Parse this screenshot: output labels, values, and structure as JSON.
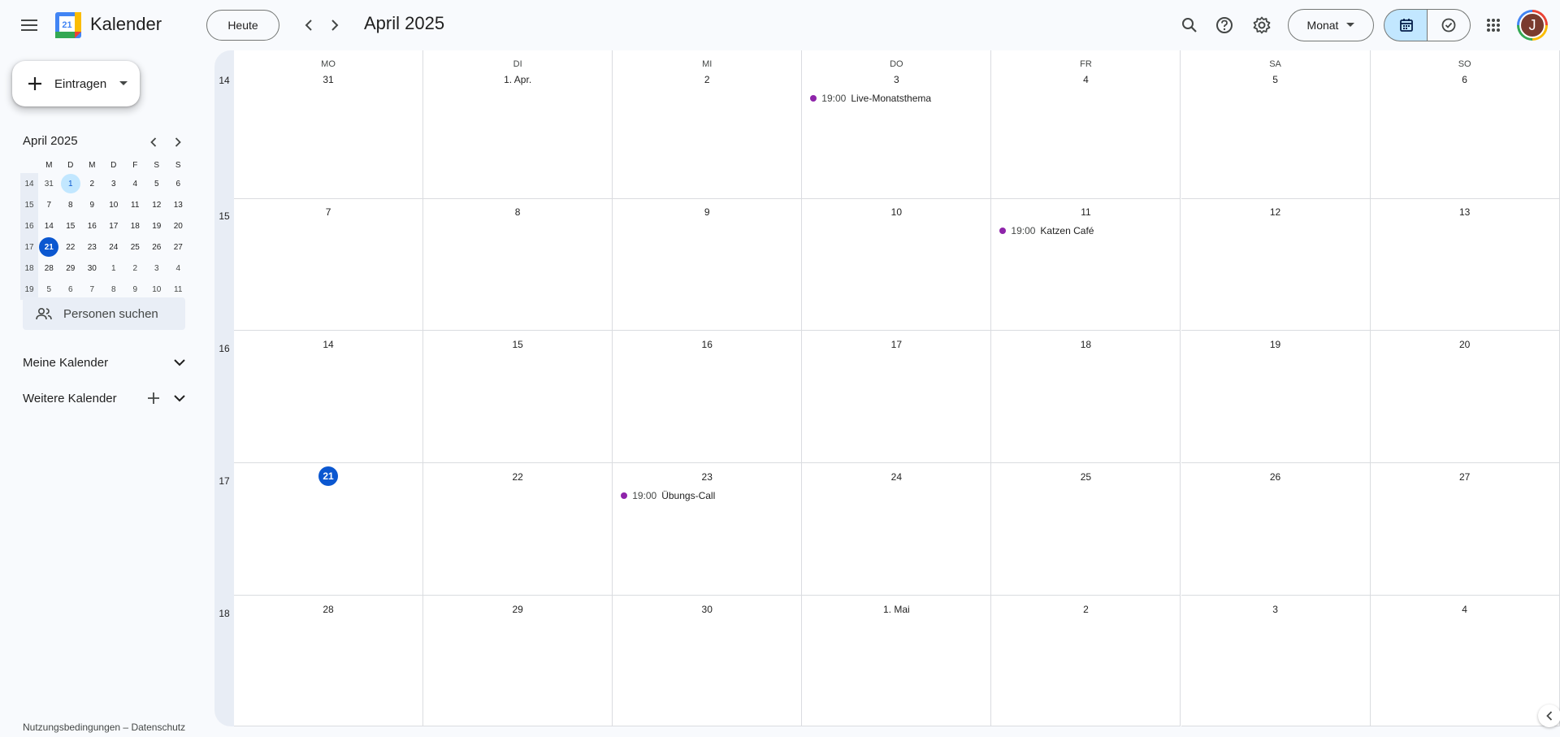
{
  "app": {
    "title": "Kalender",
    "logo_day": "21"
  },
  "header": {
    "today_label": "Heute",
    "current_period": "April 2025",
    "view_label": "Monat",
    "avatar_initial": "J"
  },
  "sidebar": {
    "create_label": "Eintragen",
    "mini_calendar": {
      "title": "April 2025",
      "weekday_headers": [
        "M",
        "D",
        "M",
        "D",
        "F",
        "S",
        "S"
      ],
      "weeks": [
        {
          "wk": "14",
          "days": [
            "31",
            "1",
            "2",
            "3",
            "4",
            "5",
            "6"
          ]
        },
        {
          "wk": "15",
          "days": [
            "7",
            "8",
            "9",
            "10",
            "11",
            "12",
            "13"
          ]
        },
        {
          "wk": "16",
          "days": [
            "14",
            "15",
            "16",
            "17",
            "18",
            "19",
            "20"
          ]
        },
        {
          "wk": "17",
          "days": [
            "21",
            "22",
            "23",
            "24",
            "25",
            "26",
            "27"
          ]
        },
        {
          "wk": "18",
          "days": [
            "28",
            "29",
            "30",
            "1",
            "2",
            "3",
            "4"
          ]
        },
        {
          "wk": "19",
          "days": [
            "5",
            "6",
            "7",
            "8",
            "9",
            "10",
            "11"
          ]
        }
      ]
    },
    "people_search_placeholder": "Personen suchen",
    "my_calendars_label": "Meine Kalender",
    "other_calendars_label": "Weitere Kalender",
    "footer": "Nutzungsbedingungen – Datenschutz"
  },
  "month_grid": {
    "weekday_headers": [
      "MO",
      "DI",
      "MI",
      "DO",
      "FR",
      "SA",
      "SO"
    ],
    "weeks": [
      {
        "wk": "14",
        "days": [
          "31",
          "1. Apr.",
          "2",
          "3",
          "4",
          "5",
          "6"
        ]
      },
      {
        "wk": "15",
        "days": [
          "7",
          "8",
          "9",
          "10",
          "11",
          "12",
          "13"
        ]
      },
      {
        "wk": "16",
        "days": [
          "14",
          "15",
          "16",
          "17",
          "18",
          "19",
          "20"
        ]
      },
      {
        "wk": "17",
        "days": [
          "21",
          "22",
          "23",
          "24",
          "25",
          "26",
          "27"
        ]
      },
      {
        "wk": "18",
        "days": [
          "28",
          "29",
          "30",
          "1. Mai",
          "2",
          "3",
          "4"
        ]
      }
    ],
    "events": [
      {
        "week": 0,
        "day": 3,
        "time": "19:00",
        "title": "Live-Monatsthema"
      },
      {
        "week": 1,
        "day": 4,
        "time": "19:00",
        "title": "Katzen Café"
      },
      {
        "week": 3,
        "day": 2,
        "time": "19:00",
        "title": "Übungs-Call"
      }
    ]
  },
  "colors": {
    "accent": "#0b57d0",
    "event_dot": "#8e24aa",
    "selected_bg": "#c2e7ff"
  }
}
